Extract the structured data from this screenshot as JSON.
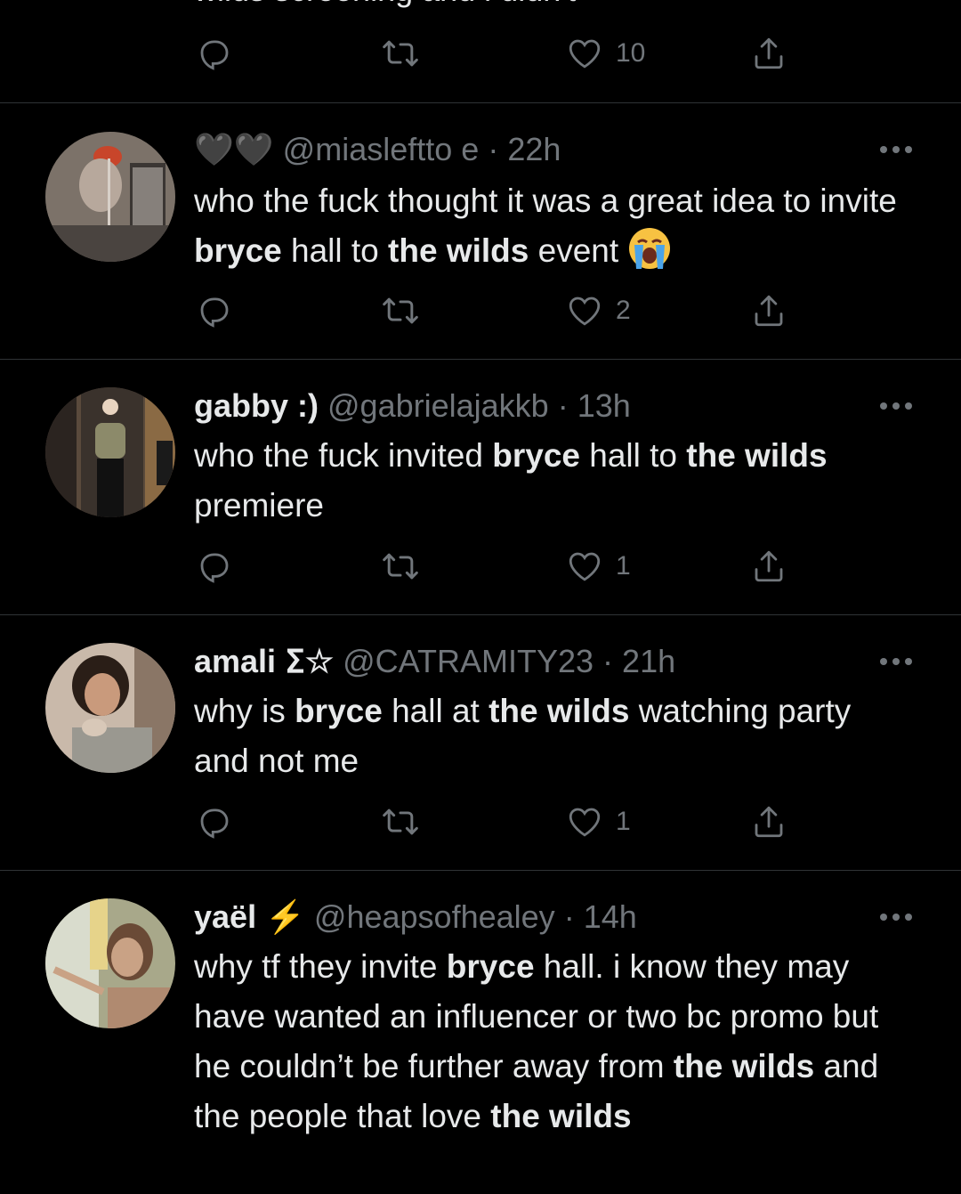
{
  "top_partial": {
    "text": "wilds screening and i didn't",
    "likes": "10"
  },
  "tweets": [
    {
      "name": "🖤🖤",
      "handle": "@miasleftto e",
      "time": "22h",
      "segments": [
        "who the fuck thought it was a great idea to invite ",
        "bryce",
        " hall to ",
        "the wilds",
        " event "
      ],
      "likes": "2"
    },
    {
      "name": "gabby :)",
      "handle": "@gabrielajakkb",
      "time": "13h",
      "segments": [
        "who the fuck invited ",
        "bryce",
        " hall to ",
        "the wilds",
        " premiere"
      ],
      "likes": "1"
    },
    {
      "name": "amali ⵉ☆",
      "handle": "@CATRAMITY23",
      "time": "21h",
      "segments": [
        "why is ",
        "bryce",
        " hall at ",
        "the wilds",
        " watching party and not me"
      ],
      "likes": "1"
    },
    {
      "name": "yaël ⚡",
      "handle": "@heapsofhealey",
      "time": "14h",
      "segments": [
        "why tf they invite ",
        "bryce",
        " hall. i know they may have wanted an influencer or two bc promo but he couldn’t be further away from ",
        "the wilds",
        " and the people that love ",
        "the wilds"
      ],
      "likes": ""
    }
  ],
  "separator": "·",
  "colors": {
    "background": "#000000",
    "text": "#e7e9ea",
    "muted": "#71767b",
    "border": "#2f3336",
    "lightning": "#f5b400"
  },
  "icons": [
    "reply-icon",
    "retweet-icon",
    "heart-icon",
    "share-icon",
    "more-icon",
    "crying-emoji-icon"
  ]
}
